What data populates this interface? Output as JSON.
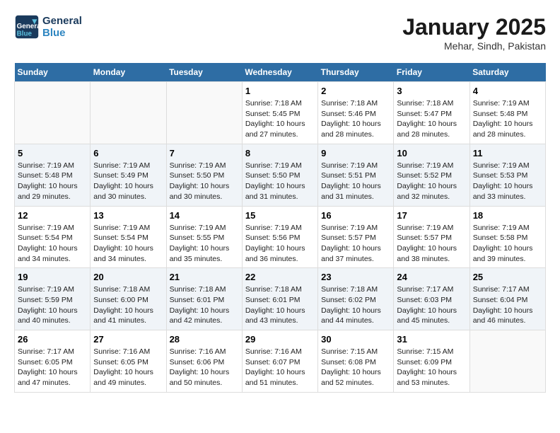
{
  "header": {
    "logo_line1": "General",
    "logo_line2": "Blue",
    "title": "January 2025",
    "subtitle": "Mehar, Sindh, Pakistan"
  },
  "columns": [
    "Sunday",
    "Monday",
    "Tuesday",
    "Wednesday",
    "Thursday",
    "Friday",
    "Saturday"
  ],
  "weeks": [
    {
      "cells": [
        {
          "empty": true
        },
        {
          "empty": true
        },
        {
          "empty": true
        },
        {
          "day": "1",
          "sunrise": "7:18 AM",
          "sunset": "5:45 PM",
          "daylight": "10 hours and 27 minutes."
        },
        {
          "day": "2",
          "sunrise": "7:18 AM",
          "sunset": "5:46 PM",
          "daylight": "10 hours and 28 minutes."
        },
        {
          "day": "3",
          "sunrise": "7:18 AM",
          "sunset": "5:47 PM",
          "daylight": "10 hours and 28 minutes."
        },
        {
          "day": "4",
          "sunrise": "7:19 AM",
          "sunset": "5:48 PM",
          "daylight": "10 hours and 28 minutes."
        }
      ]
    },
    {
      "cells": [
        {
          "day": "5",
          "sunrise": "7:19 AM",
          "sunset": "5:48 PM",
          "daylight": "10 hours and 29 minutes."
        },
        {
          "day": "6",
          "sunrise": "7:19 AM",
          "sunset": "5:49 PM",
          "daylight": "10 hours and 30 minutes."
        },
        {
          "day": "7",
          "sunrise": "7:19 AM",
          "sunset": "5:50 PM",
          "daylight": "10 hours and 30 minutes."
        },
        {
          "day": "8",
          "sunrise": "7:19 AM",
          "sunset": "5:50 PM",
          "daylight": "10 hours and 31 minutes."
        },
        {
          "day": "9",
          "sunrise": "7:19 AM",
          "sunset": "5:51 PM",
          "daylight": "10 hours and 31 minutes."
        },
        {
          "day": "10",
          "sunrise": "7:19 AM",
          "sunset": "5:52 PM",
          "daylight": "10 hours and 32 minutes."
        },
        {
          "day": "11",
          "sunrise": "7:19 AM",
          "sunset": "5:53 PM",
          "daylight": "10 hours and 33 minutes."
        }
      ]
    },
    {
      "cells": [
        {
          "day": "12",
          "sunrise": "7:19 AM",
          "sunset": "5:54 PM",
          "daylight": "10 hours and 34 minutes."
        },
        {
          "day": "13",
          "sunrise": "7:19 AM",
          "sunset": "5:54 PM",
          "daylight": "10 hours and 34 minutes."
        },
        {
          "day": "14",
          "sunrise": "7:19 AM",
          "sunset": "5:55 PM",
          "daylight": "10 hours and 35 minutes."
        },
        {
          "day": "15",
          "sunrise": "7:19 AM",
          "sunset": "5:56 PM",
          "daylight": "10 hours and 36 minutes."
        },
        {
          "day": "16",
          "sunrise": "7:19 AM",
          "sunset": "5:57 PM",
          "daylight": "10 hours and 37 minutes."
        },
        {
          "day": "17",
          "sunrise": "7:19 AM",
          "sunset": "5:57 PM",
          "daylight": "10 hours and 38 minutes."
        },
        {
          "day": "18",
          "sunrise": "7:19 AM",
          "sunset": "5:58 PM",
          "daylight": "10 hours and 39 minutes."
        }
      ]
    },
    {
      "cells": [
        {
          "day": "19",
          "sunrise": "7:19 AM",
          "sunset": "5:59 PM",
          "daylight": "10 hours and 40 minutes."
        },
        {
          "day": "20",
          "sunrise": "7:18 AM",
          "sunset": "6:00 PM",
          "daylight": "10 hours and 41 minutes."
        },
        {
          "day": "21",
          "sunrise": "7:18 AM",
          "sunset": "6:01 PM",
          "daylight": "10 hours and 42 minutes."
        },
        {
          "day": "22",
          "sunrise": "7:18 AM",
          "sunset": "6:01 PM",
          "daylight": "10 hours and 43 minutes."
        },
        {
          "day": "23",
          "sunrise": "7:18 AM",
          "sunset": "6:02 PM",
          "daylight": "10 hours and 44 minutes."
        },
        {
          "day": "24",
          "sunrise": "7:17 AM",
          "sunset": "6:03 PM",
          "daylight": "10 hours and 45 minutes."
        },
        {
          "day": "25",
          "sunrise": "7:17 AM",
          "sunset": "6:04 PM",
          "daylight": "10 hours and 46 minutes."
        }
      ]
    },
    {
      "cells": [
        {
          "day": "26",
          "sunrise": "7:17 AM",
          "sunset": "6:05 PM",
          "daylight": "10 hours and 47 minutes."
        },
        {
          "day": "27",
          "sunrise": "7:16 AM",
          "sunset": "6:05 PM",
          "daylight": "10 hours and 49 minutes."
        },
        {
          "day": "28",
          "sunrise": "7:16 AM",
          "sunset": "6:06 PM",
          "daylight": "10 hours and 50 minutes."
        },
        {
          "day": "29",
          "sunrise": "7:16 AM",
          "sunset": "6:07 PM",
          "daylight": "10 hours and 51 minutes."
        },
        {
          "day": "30",
          "sunrise": "7:15 AM",
          "sunset": "6:08 PM",
          "daylight": "10 hours and 52 minutes."
        },
        {
          "day": "31",
          "sunrise": "7:15 AM",
          "sunset": "6:09 PM",
          "daylight": "10 hours and 53 minutes."
        },
        {
          "empty": true
        }
      ]
    }
  ],
  "labels": {
    "sunrise": "Sunrise:",
    "sunset": "Sunset:",
    "daylight": "Daylight:"
  }
}
